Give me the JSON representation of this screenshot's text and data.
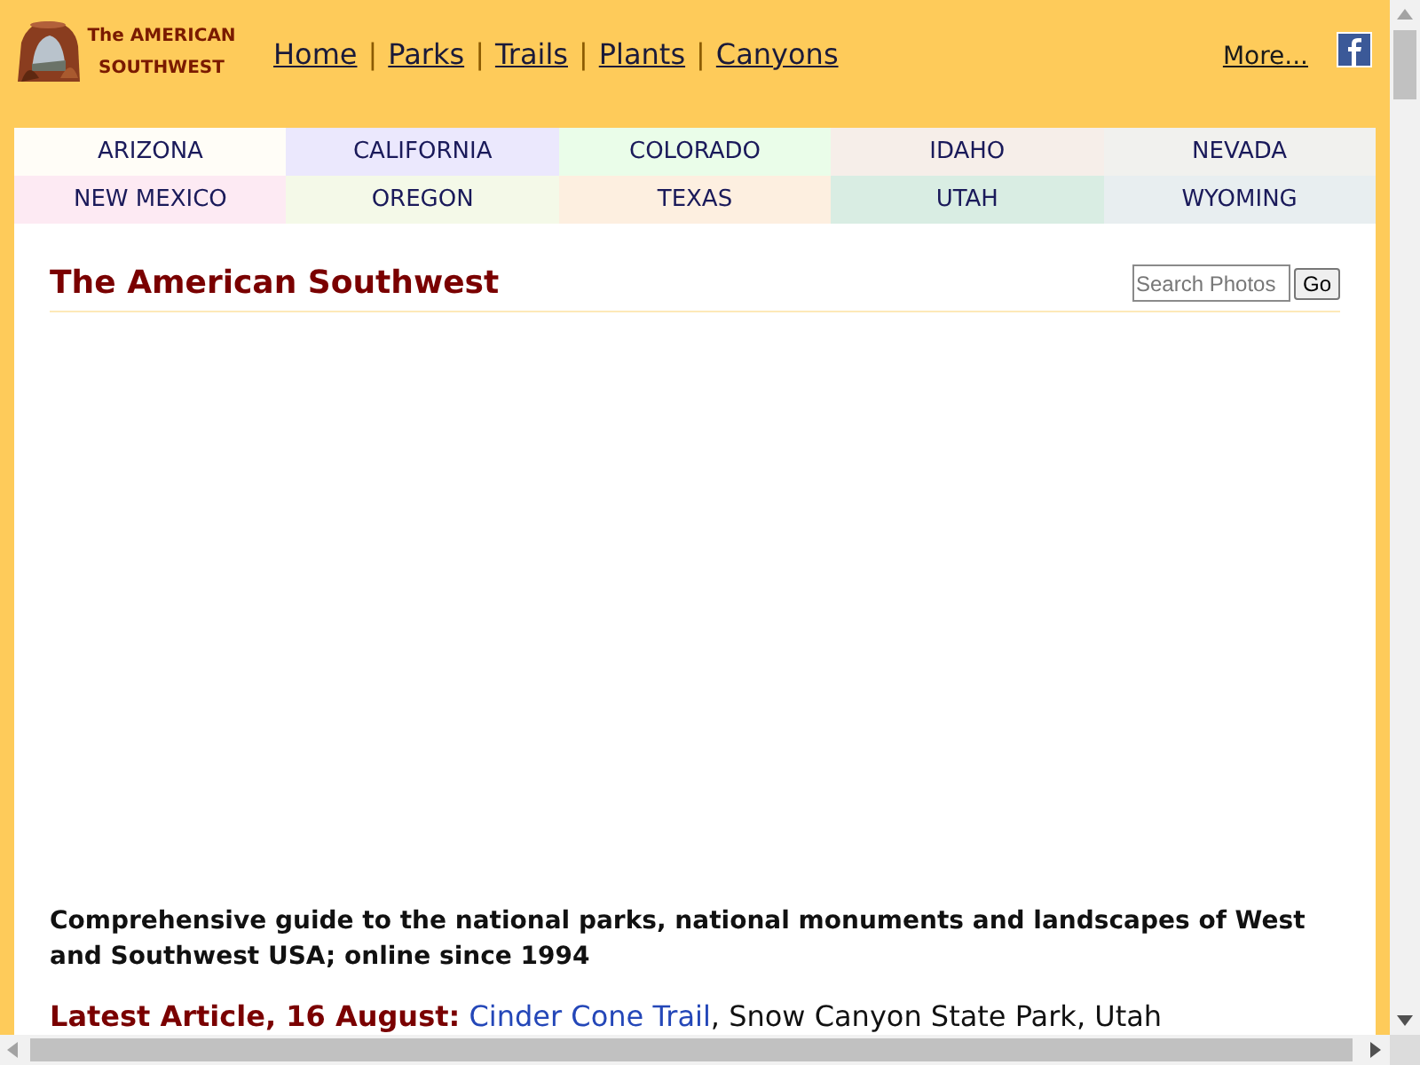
{
  "header": {
    "logo_lines": [
      "The AMERICAN",
      "SOUTHWEST"
    ],
    "nav": [
      {
        "label": "Home",
        "separator": "|"
      },
      {
        "label": "Parks",
        "separator": "|"
      },
      {
        "label": "Trails",
        "separator": "|"
      },
      {
        "label": "Plants",
        "separator": "|"
      },
      {
        "label": "Canyons"
      }
    ],
    "more_link": "More..."
  },
  "states": [
    {
      "label": "ARIZONA",
      "color": "#fffdf7"
    },
    {
      "label": "CALIFORNIA",
      "color": "#ebe8fd"
    },
    {
      "label": "COLORADO",
      "color": "#eafde9"
    },
    {
      "label": "IDAHO",
      "color": "#f6eee9"
    },
    {
      "label": "NEVADA",
      "color": "#f1f1ee"
    },
    {
      "label": "NEW MEXICO",
      "color": "#fdeaf3"
    },
    {
      "label": "OREGON",
      "color": "#f4f9e8"
    },
    {
      "label": "TEXAS",
      "color": "#fdefe0"
    },
    {
      "label": "UTAH",
      "color": "#d9ede3"
    },
    {
      "label": "WYOMING",
      "color": "#e8eef0"
    }
  ],
  "page_title": "The American Southwest",
  "search": {
    "placeholder": "Search Photos",
    "button": "Go"
  },
  "intro": "Comprehensive guide to the national parks, national monuments and landscapes of West and Southwest USA; online since 1994",
  "latest": {
    "label": "Latest Article, 16 August:",
    "link": "Cinder Cone Trail",
    "rest": ", Snow Canyon State Park, Utah"
  }
}
